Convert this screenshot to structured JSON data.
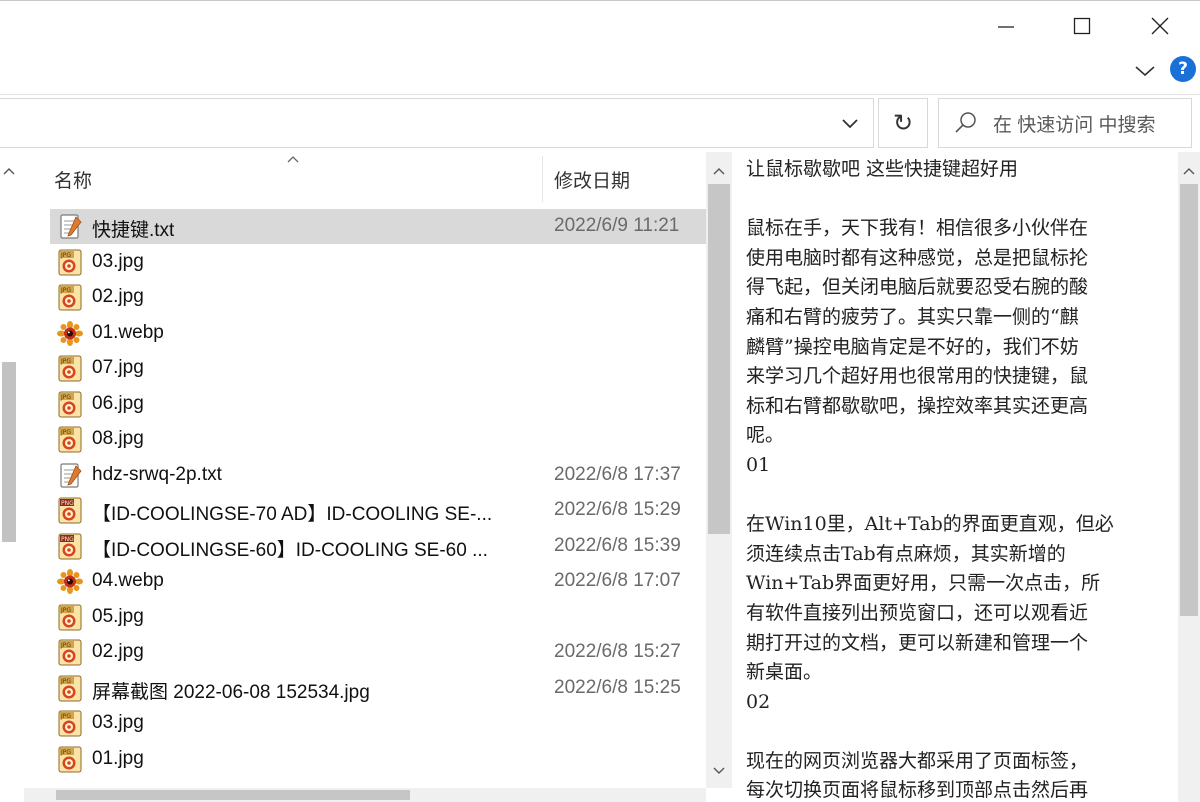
{
  "window": {
    "minimize_label": "minimize",
    "maximize_label": "maximize",
    "close_label": "close",
    "help_label": "?"
  },
  "search": {
    "placeholder": "在 快速访问 中搜索"
  },
  "refresh_glyph": "↻",
  "columns": {
    "name": "名称",
    "date": "修改日期",
    "sort_glyph": "^"
  },
  "files": [
    {
      "name": "快捷键.txt",
      "date": "2022/6/9 11:21",
      "icon": "text-file-icon",
      "selected": true
    },
    {
      "name": "03.jpg",
      "date": "",
      "icon": "jpg-file-icon"
    },
    {
      "name": "02.jpg",
      "date": "",
      "icon": "jpg-file-icon"
    },
    {
      "name": "01.webp",
      "date": "",
      "icon": "webp-file-icon"
    },
    {
      "name": "07.jpg",
      "date": "",
      "icon": "jpg-file-icon"
    },
    {
      "name": "06.jpg",
      "date": "",
      "icon": "jpg-file-icon"
    },
    {
      "name": "08.jpg",
      "date": "",
      "icon": "jpg-file-icon"
    },
    {
      "name": "hdz-srwq-2p.txt",
      "date": "2022/6/8 17:37",
      "icon": "text-file-icon"
    },
    {
      "name": "【ID-COOLINGSE-70 AD】ID-COOLING SE-...",
      "date": "2022/6/8 15:29",
      "icon": "png-file-icon"
    },
    {
      "name": "【ID-COOLINGSE-60】ID-COOLING SE-60 ...",
      "date": "2022/6/8 15:39",
      "icon": "png-file-icon"
    },
    {
      "name": "04.webp",
      "date": "2022/6/8 17:07",
      "icon": "webp-file-icon"
    },
    {
      "name": "05.jpg",
      "date": "",
      "icon": "jpg-file-icon"
    },
    {
      "name": "02.jpg",
      "date": "2022/6/8 15:27",
      "icon": "jpg-file-icon"
    },
    {
      "name": "屏幕截图 2022-06-08 152534.jpg",
      "date": "2022/6/8 15:25",
      "icon": "jpg-file-icon"
    },
    {
      "name": "03.jpg",
      "date": "",
      "icon": "jpg-file-icon"
    },
    {
      "name": "01.jpg",
      "date": "",
      "icon": "jpg-file-icon"
    }
  ],
  "preview_text": "让鼠标歇歇吧 这些快捷键超好用\n\n鼠标在手，天下我有！相信很多小伙伴在\n使用电脑时都有这种感觉，总是把鼠标抡\n得飞起，但关闭电脑后就要忍受右腕的酸\n痛和右臂的疲劳了。其实只靠一侧的“麒\n麟臂”操控电脑肯定是不好的，我们不妨\n来学习几个超好用也很常用的快捷键，鼠\n标和右臂都歇歇吧，操控效率其实还更高\n呢。\n01\n\n在Win10里，Alt+Tab的界面更直观，但必\n须连续点击Tab有点麻烦，其实新增的\nWin+Tab界面更好用，只需一次点击，所\n有软件直接列出预览窗口，还可以观看近\n期打开过的文档，更可以新建和管理一个\n新桌面。\n02\n\n现在的网页浏览器大都采用了页面标签，\n每次切换页面将鼠标移到顶部点击然后再",
  "colors": {
    "selection": "#d9d9d9",
    "accent": "#1a6fd9",
    "scrollbar_thumb": "#c6c6c6",
    "scrollbar_track": "#f0f0f0"
  }
}
